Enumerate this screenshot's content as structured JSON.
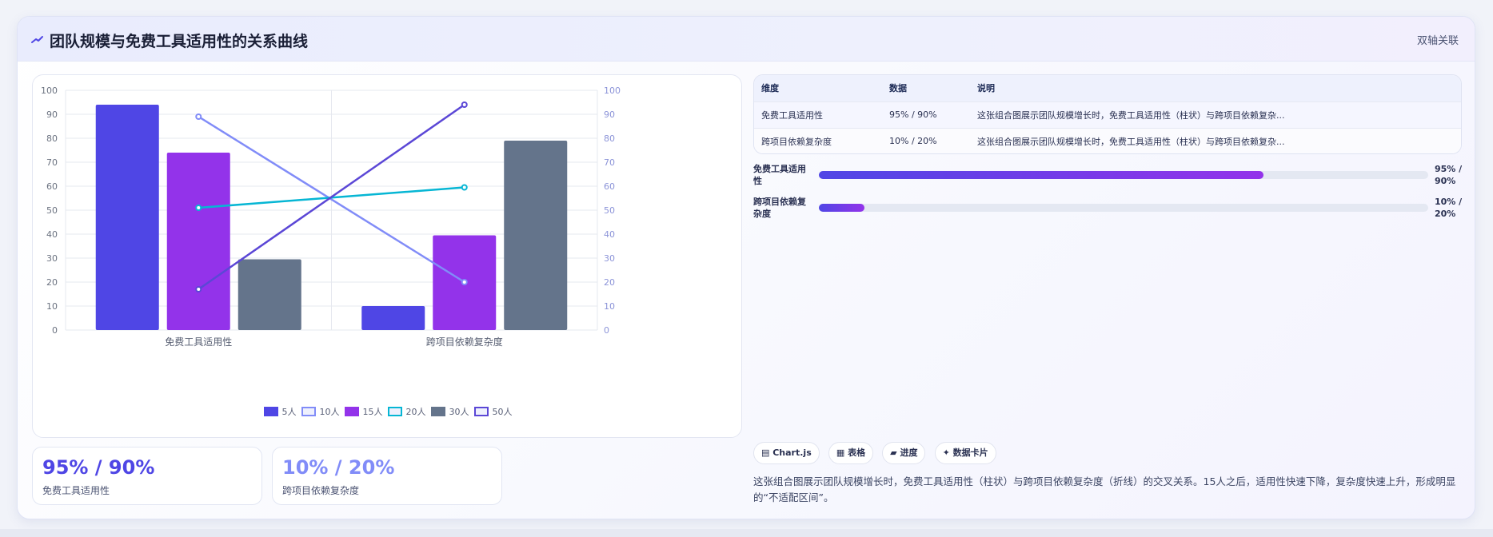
{
  "header": {
    "title": "团队规模与免费工具适用性的关系曲线",
    "tag": "双轴关联",
    "icon": "trend-line-icon"
  },
  "chart_data": {
    "type": "bar",
    "categories": [
      "免费工具适用性",
      "跨项目依赖复杂度"
    ],
    "series": [
      {
        "name": "5人",
        "type": "bar",
        "values": [
          94,
          10
        ],
        "color": "#4f46e5"
      },
      {
        "name": "10人",
        "type": "line",
        "values": [
          89,
          20
        ],
        "color": "#818cf8"
      },
      {
        "name": "15人",
        "type": "bar",
        "values": [
          74,
          39.5
        ],
        "color": "#9333ea"
      },
      {
        "name": "20人",
        "type": "line",
        "values": [
          51,
          59.5
        ],
        "color": "#06b6d4"
      },
      {
        "name": "30人",
        "type": "bar",
        "values": [
          29.5,
          79
        ],
        "color": "#64748b"
      },
      {
        "name": "50人",
        "type": "line",
        "values": [
          17,
          94
        ],
        "color": "#5b47d6"
      }
    ],
    "ylim": [
      0,
      100
    ],
    "y2lim": [
      0,
      100
    ],
    "yticks": [
      0,
      10,
      20,
      30,
      40,
      50,
      60,
      70,
      80,
      90,
      100
    ],
    "grid": true,
    "legend": "bottom"
  },
  "table": {
    "headers": [
      "维度",
      "数据",
      "说明"
    ],
    "rows": [
      [
        "免费工具适用性",
        "95% / 90%",
        "这张组合图展示团队规模增长时，免费工具适用性（柱状）与跨项目依赖复杂..."
      ],
      [
        "跨项目依赖复杂度",
        "10% / 20%",
        "这张组合图展示团队规模增长时，免费工具适用性（柱状）与跨项目依赖复杂..."
      ]
    ]
  },
  "progress": [
    {
      "label": "免费工具适用性",
      "value_text": "95% / 90%",
      "fraction": 0.73
    },
    {
      "label": "跨项目依赖复杂度",
      "value_text": "10% / 20%",
      "fraction": 0.075
    }
  ],
  "kpis": [
    {
      "value": "95% / 90%",
      "label": "免费工具适用性",
      "color": "#4f46e5"
    },
    {
      "value": "10% / 20%",
      "label": "跨项目依赖复杂度",
      "color": "#818cf8"
    }
  ],
  "chips": [
    {
      "label": "Chart.js",
      "icon": "chart-icon"
    },
    {
      "label": "表格",
      "icon": "table-icon"
    },
    {
      "label": "进度",
      "icon": "progress-icon"
    },
    {
      "label": "数据卡片",
      "icon": "sparkle-icon"
    }
  ],
  "description": "这张组合图展示团队规模增长时，免费工具适用性（柱状）与跨项目依赖复杂度（折线）的交叉关系。15人之后，适用性快速下降，复杂度快速上升，形成明显的“不适配区间”。"
}
